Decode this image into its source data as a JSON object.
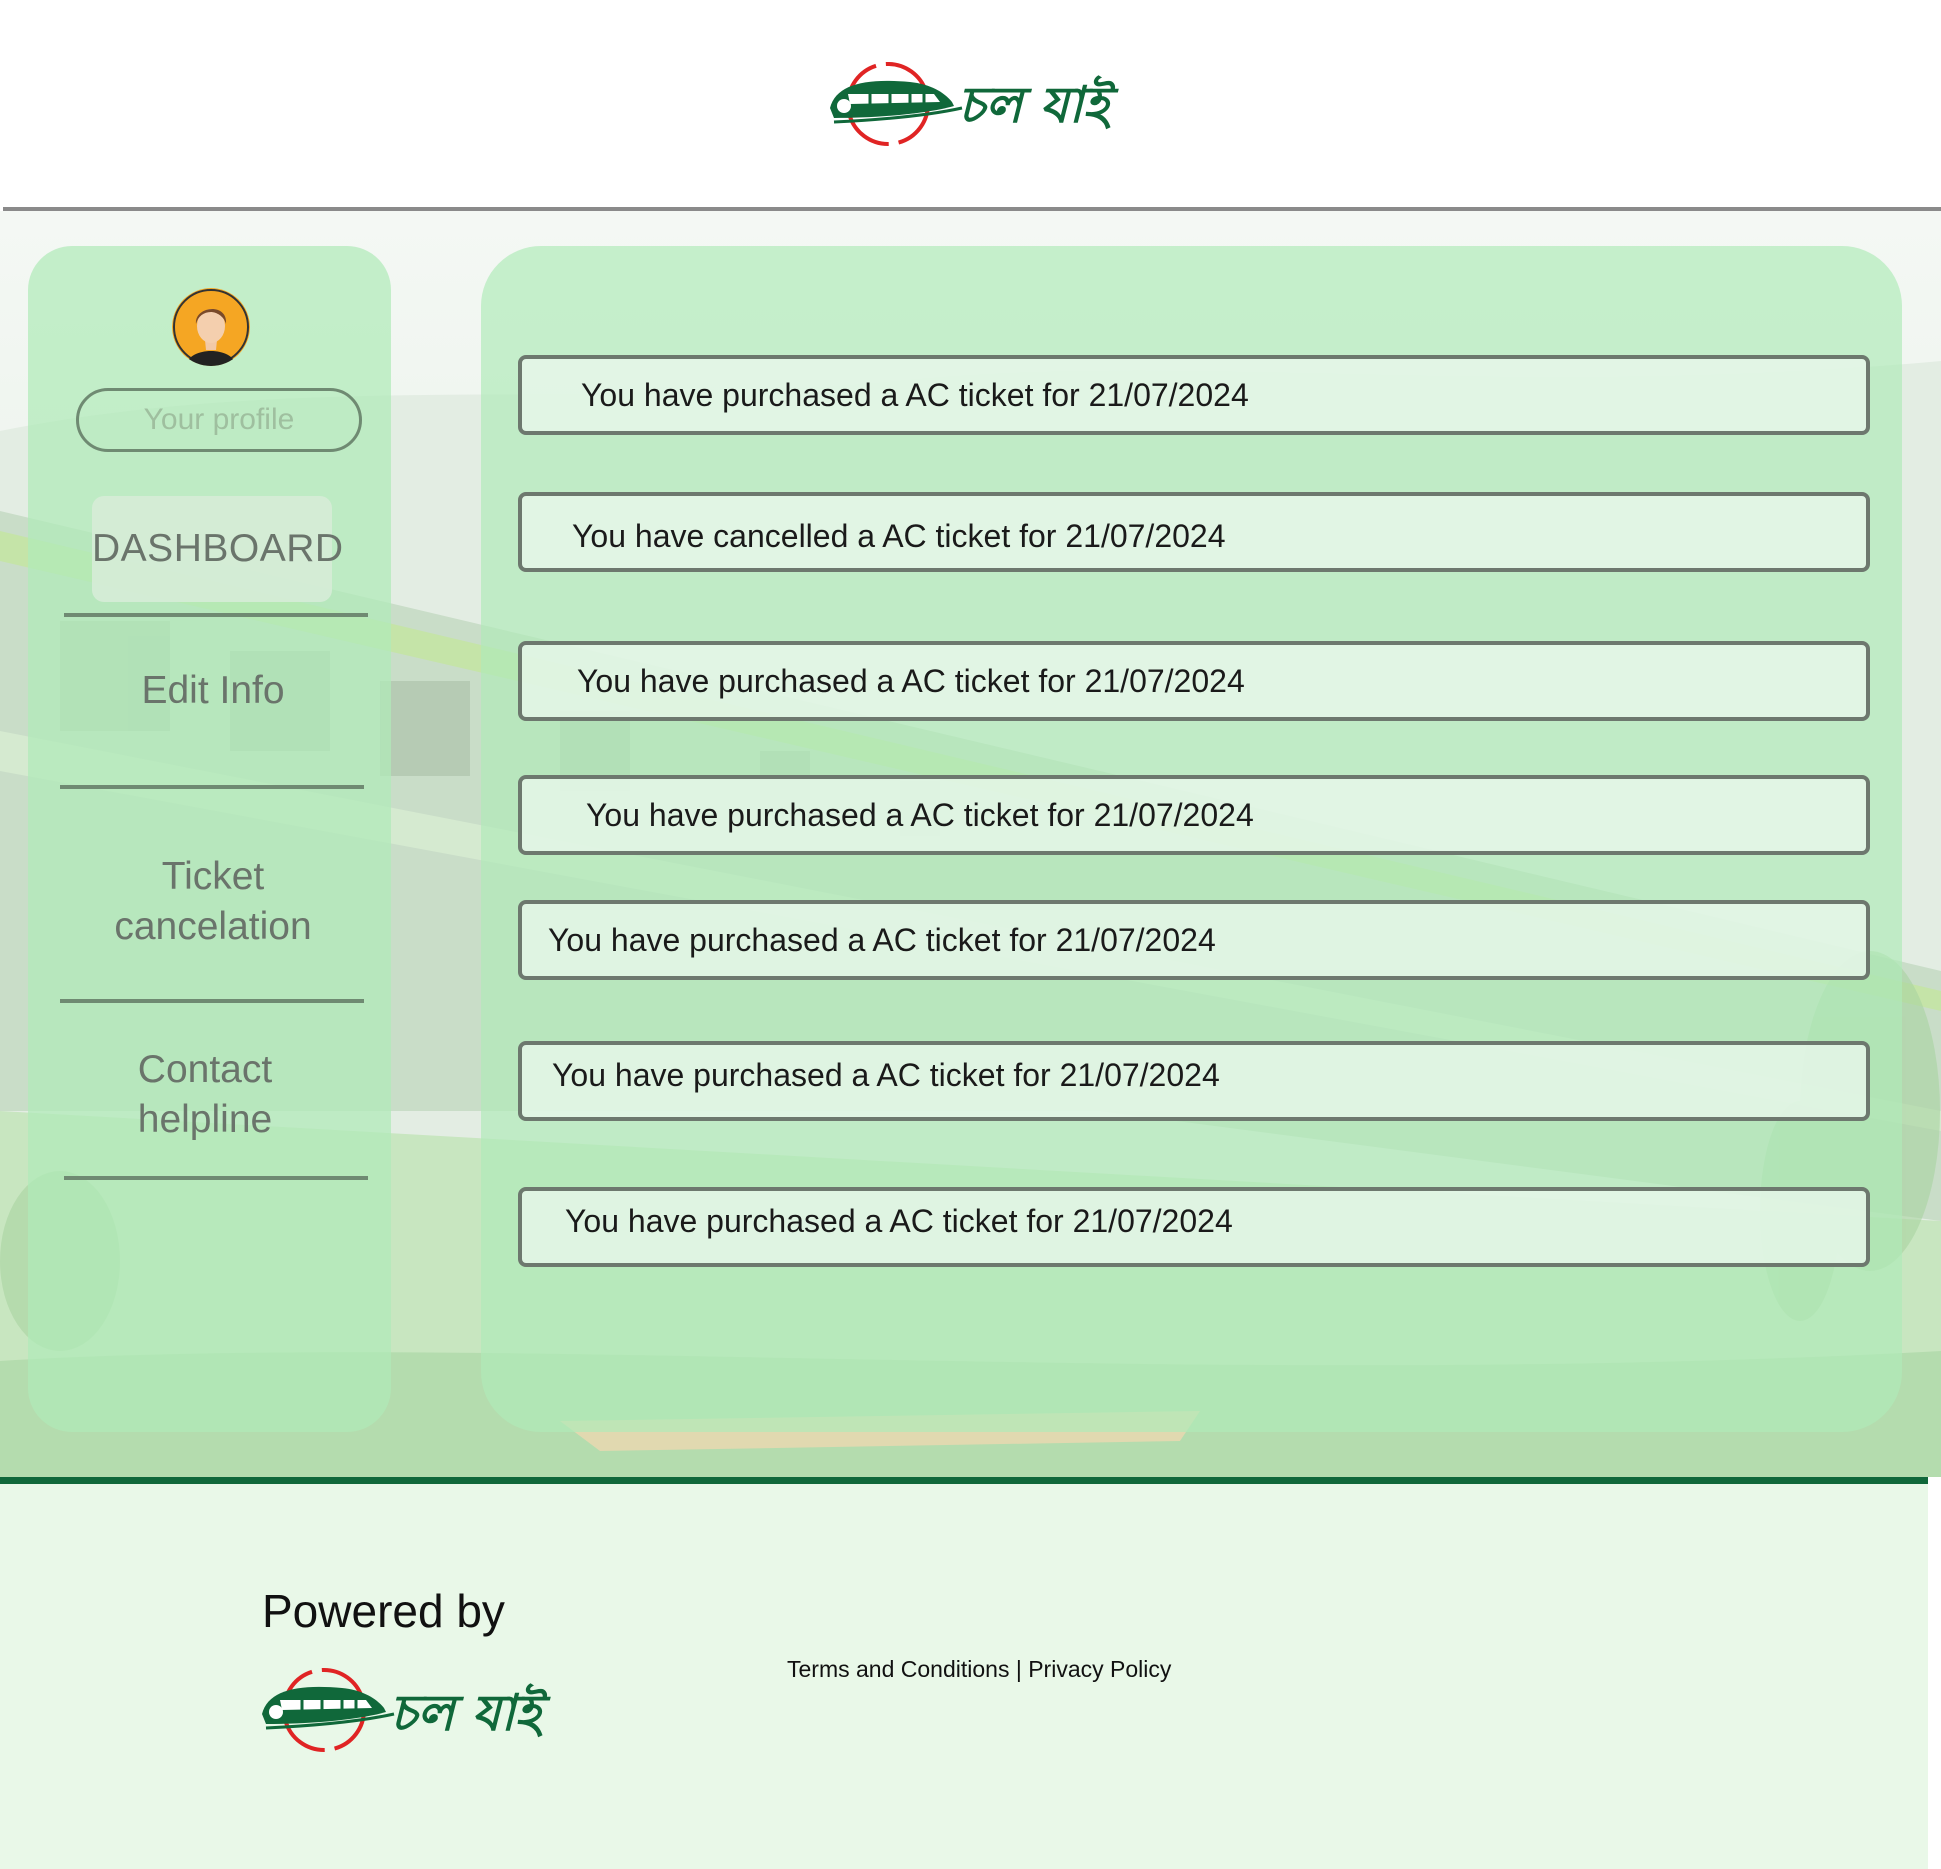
{
  "header": {
    "logo_text": "চল যাই"
  },
  "sidebar": {
    "profile_label": "Your profile",
    "items": [
      {
        "label": "DASHBOARD",
        "active": true
      },
      {
        "label": "Edit Info"
      },
      {
        "label_lines": [
          "Ticket",
          "cancelation"
        ]
      },
      {
        "label_lines": [
          "Contact",
          "helpline"
        ]
      }
    ]
  },
  "activity": [
    {
      "text": "You have purchased a AC ticket for 21/07/2024"
    },
    {
      "text": "You have cancelled a AC ticket for 21/07/2024"
    },
    {
      "text": "You have purchased a AC ticket for 21/07/2024"
    },
    {
      "text": "You have purchased a AC ticket for 21/07/2024"
    },
    {
      "text": "You have purchased a AC ticket for 21/07/2024"
    },
    {
      "text": "You have purchased a AC ticket for 21/07/2024"
    },
    {
      "text": "You have purchased a AC ticket for 21/07/2024"
    }
  ],
  "footer": {
    "powered_by": "Powered by",
    "logo_text": "চল যাই",
    "terms": "Terms and Conditions",
    "separator": "|",
    "privacy": "Privacy Policy"
  },
  "colors": {
    "brand_green": "#10683a",
    "brand_red": "#e02424",
    "panel_green": "#b0eab8"
  }
}
